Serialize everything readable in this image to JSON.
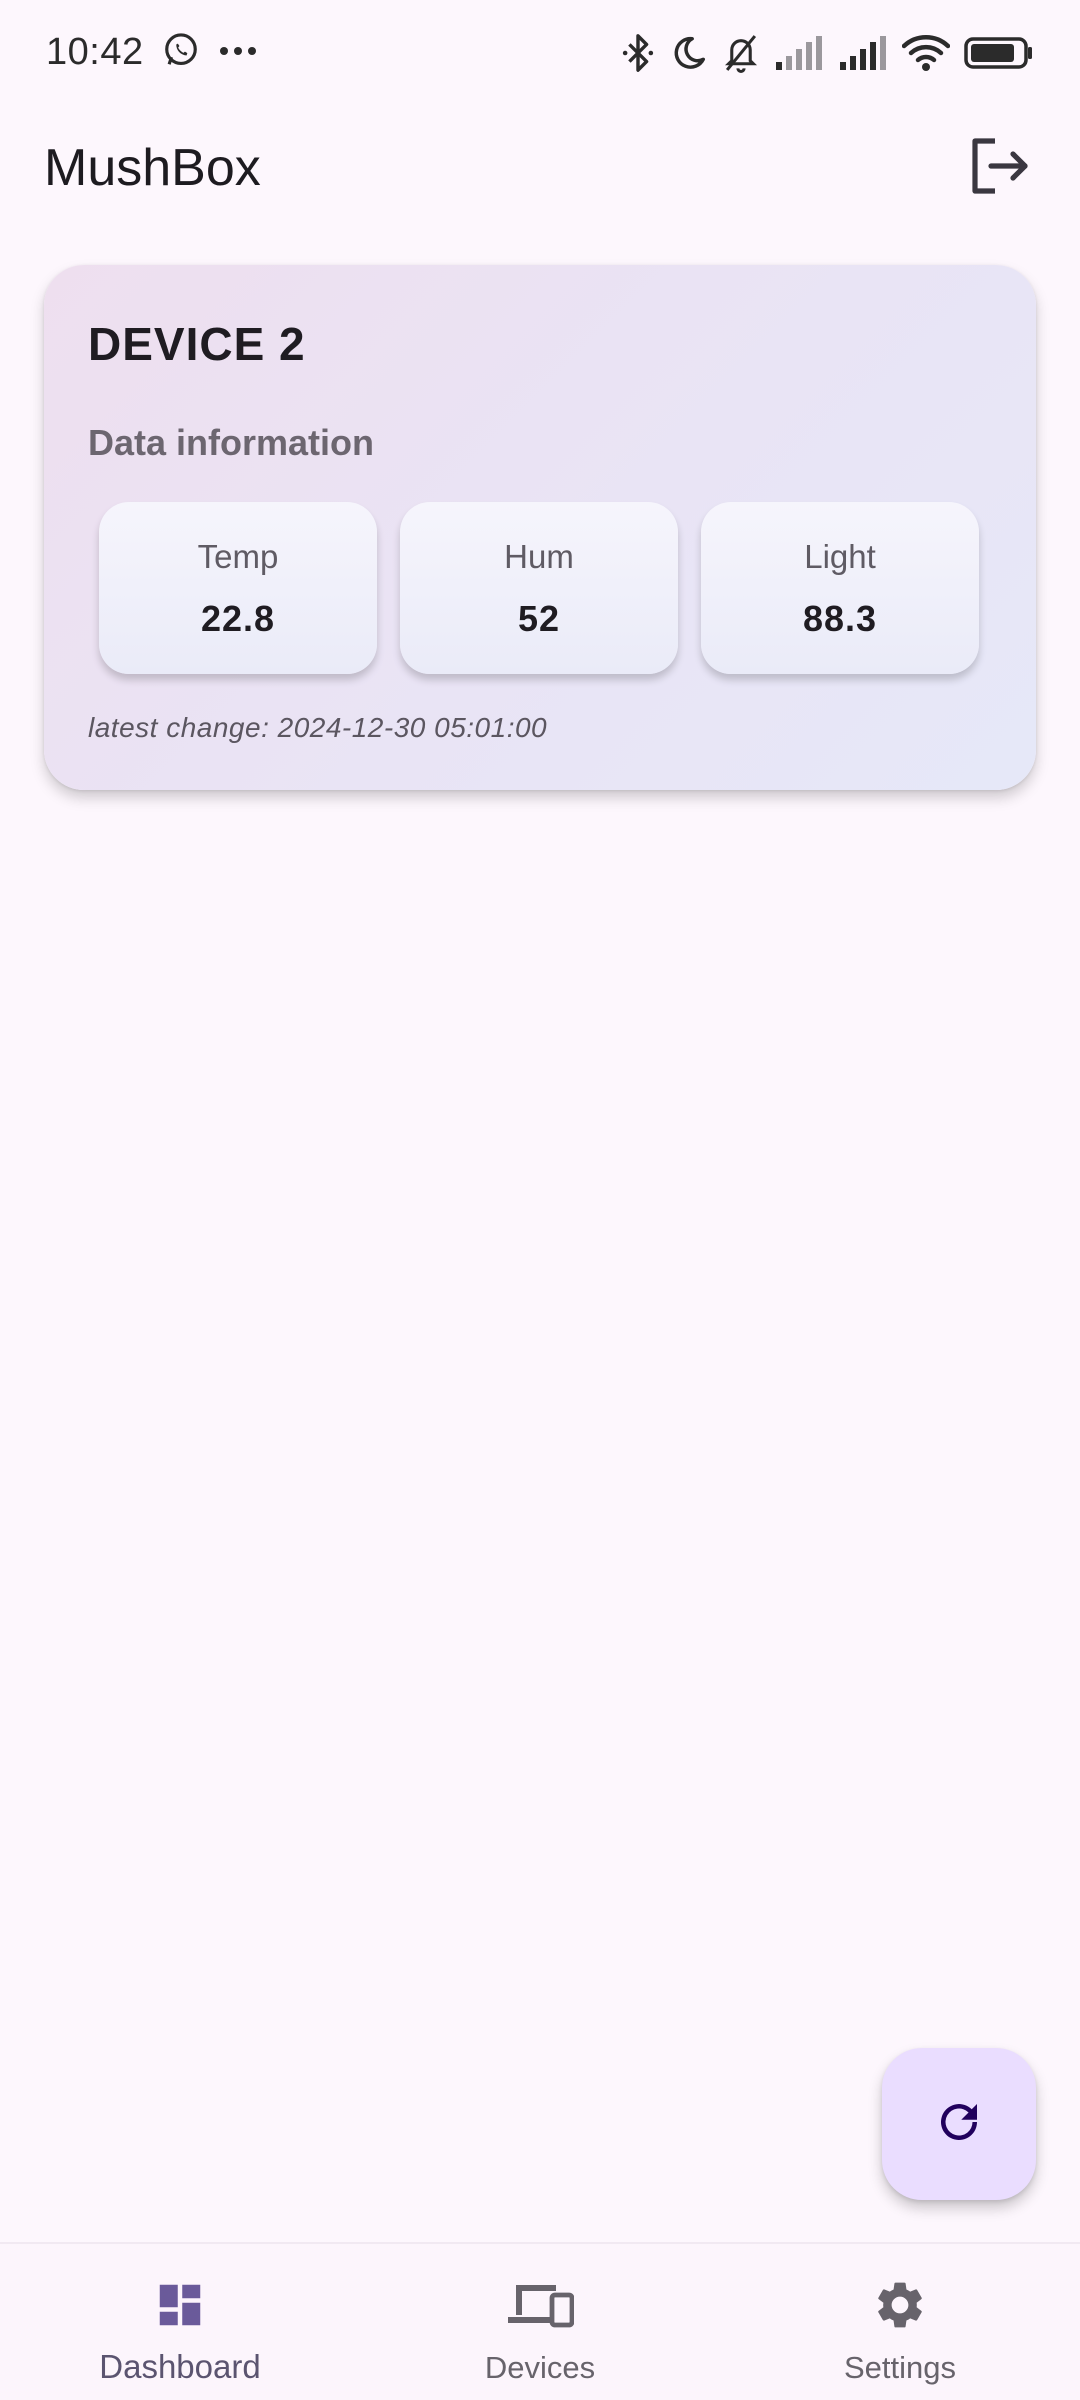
{
  "status_bar": {
    "time": "10:42",
    "overflow": "···",
    "icons": [
      "whatsapp-icon",
      "bluetooth-icon",
      "do-not-disturb-moon-icon",
      "bell-off-icon",
      "signal-icon",
      "signal-icon",
      "wifi-icon",
      "battery-icon"
    ]
  },
  "app_bar": {
    "title": "MushBox",
    "action_icon": "logout-icon"
  },
  "device_card": {
    "title": "DEVICE 2",
    "subtitle": "Data information",
    "metrics": [
      {
        "label": "Temp",
        "value": "22.8"
      },
      {
        "label": "Hum",
        "value": "52"
      },
      {
        "label": "Light",
        "value": "88.3"
      }
    ],
    "latest_change": "latest change: 2024-12-30 05:01:00"
  },
  "fab": {
    "icon": "refresh-icon"
  },
  "bottom_nav": {
    "items": [
      {
        "label": "Dashboard",
        "icon": "dashboard-icon",
        "active": true
      },
      {
        "label": "Devices",
        "icon": "devices-icon",
        "active": false
      },
      {
        "label": "Settings",
        "icon": "gear-icon",
        "active": false
      }
    ]
  },
  "colors": {
    "background": "#FDF7FD",
    "accent": "#6A5A9A",
    "fab": "#EADDFF",
    "text_primary": "#1D1B20"
  }
}
